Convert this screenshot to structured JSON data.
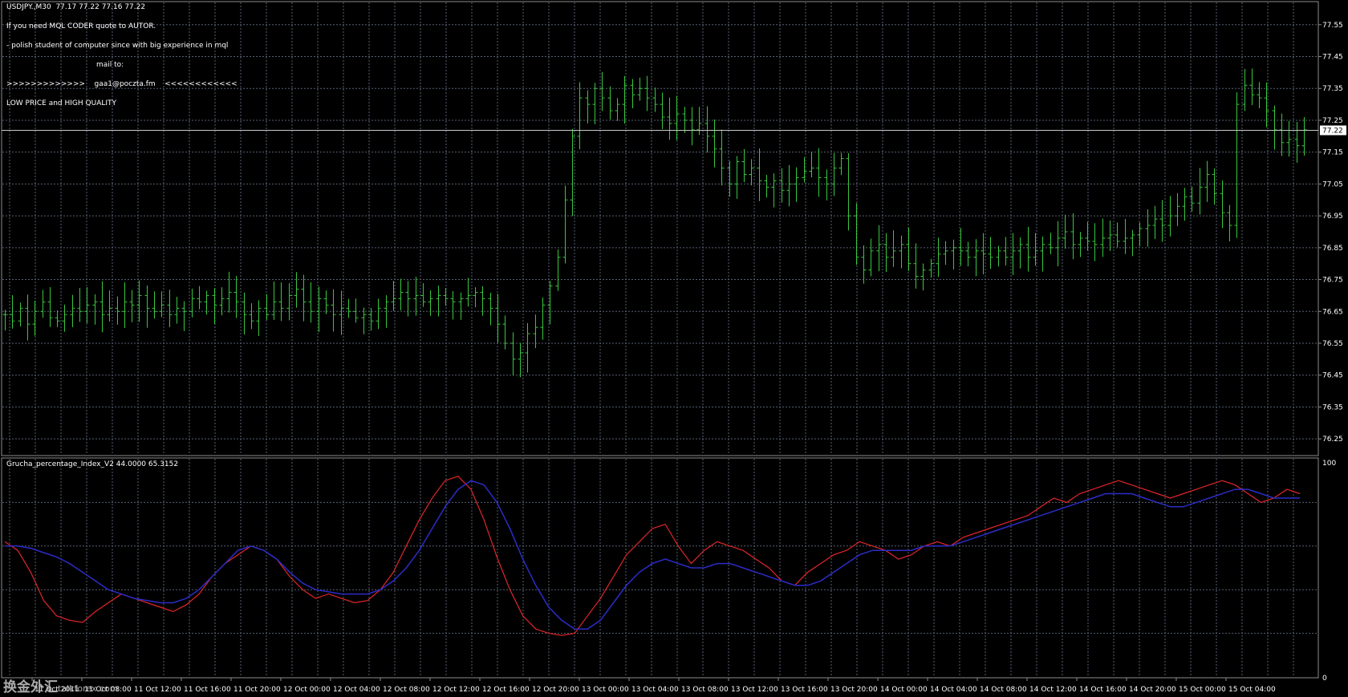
{
  "header": {
    "symbol_line": "USDJPY.,M30  77.17 77.22 77.16 77.22",
    "lines": [
      "If you need MQL CODER quote to AUTOR.",
      "- polish student of computer since with big experience in mql",
      "mail to:",
      ">>>>>>>>>>>>>    gaa1@poczta.fm    <<<<<<<<<<<<",
      "LOW PRICE and HIGH QUALITY"
    ]
  },
  "indicator": {
    "label": "Grucha_percentage_Index_V2 44.0000 65.3152",
    "scale_top": "100",
    "scale_bottom": "0"
  },
  "watermark": {
    "text": "换金外汇",
    "sub": "talkforex.com"
  },
  "colors": {
    "background": "#000000",
    "grid": "#566173",
    "bars": "#39c63e",
    "red_line": "#e0262a",
    "blue_line": "#2c2cc8",
    "text": "#ffffff"
  },
  "chart_data": [
    {
      "type": "ohlc",
      "symbol": "USDJPY.",
      "timeframe": "M30",
      "last_price": "77.22",
      "ylim": [
        76.2,
        77.62
      ],
      "yticks": [
        "77.55",
        "77.45",
        "77.35",
        "77.25",
        "77.15",
        "77.05",
        "76.95",
        "76.85",
        "76.75",
        "76.65",
        "76.55",
        "76.45",
        "76.35",
        "76.25"
      ],
      "close": [
        76.64,
        76.62,
        76.66,
        76.61,
        76.65,
        76.68,
        76.63,
        76.62,
        76.64,
        76.66,
        76.65,
        76.67,
        76.68,
        76.64,
        76.66,
        76.65,
        76.68,
        76.67,
        76.7,
        76.66,
        76.65,
        76.67,
        76.64,
        76.66,
        76.65,
        76.69,
        76.68,
        76.7,
        76.67,
        76.69,
        76.71,
        76.68,
        76.64,
        76.62,
        76.66,
        76.64,
        76.68,
        76.66,
        76.7,
        76.72,
        76.68,
        76.65,
        76.69,
        76.67,
        76.64,
        76.66,
        76.65,
        76.63,
        76.64,
        76.62,
        76.66,
        76.68,
        76.69,
        76.71,
        76.69,
        76.7,
        76.68,
        76.69,
        76.7,
        76.69,
        76.68,
        76.69,
        76.7,
        76.71,
        76.69,
        76.66,
        76.61,
        76.55,
        76.5,
        76.52,
        76.58,
        76.6,
        76.67,
        76.73,
        76.82,
        77.0,
        77.2,
        77.32,
        77.3,
        77.35,
        77.32,
        77.28,
        77.3,
        77.36,
        77.33,
        77.35,
        77.32,
        77.3,
        77.26,
        77.24,
        77.27,
        77.25,
        77.22,
        77.24,
        77.2,
        77.16,
        77.1,
        77.05,
        77.12,
        77.08,
        77.1,
        77.06,
        77.04,
        77.06,
        77.03,
        77.05,
        77.07,
        77.09,
        77.1,
        77.07,
        77.05,
        77.1,
        77.13,
        76.95,
        76.82,
        76.78,
        76.84,
        76.86,
        76.82,
        76.84,
        76.86,
        76.8,
        76.76,
        76.78,
        76.8,
        76.83,
        76.84,
        76.85,
        76.84,
        76.82,
        76.84,
        76.83,
        76.82,
        76.84,
        76.82,
        76.84,
        76.86,
        76.82,
        76.84,
        76.86,
        76.85,
        76.88,
        76.9,
        76.86,
        76.88,
        76.87,
        76.86,
        76.88,
        76.89,
        76.87,
        76.88,
        76.89,
        76.91,
        76.92,
        76.94,
        76.92,
        76.95,
        76.98,
        77.01,
        76.99,
        77.04,
        77.08,
        77.02,
        76.96,
        76.92,
        77.3,
        77.36,
        77.33,
        77.32,
        77.28,
        77.22,
        77.18,
        77.19,
        77.17,
        77.22
      ],
      "yaxis_side": "right"
    },
    {
      "type": "line",
      "title": "Grucha_percentage_Index_V2 44.0000 65.3152",
      "ylim": [
        0,
        100
      ],
      "x": [
        "11 Oct 2011",
        "11 Oct 08:00",
        "11 Oct 12:00",
        "11 Oct 16:00",
        "11 Oct 20:00",
        "12 Oct 00:00",
        "12 Oct 04:00",
        "12 Oct 08:00",
        "12 Oct 12:00",
        "12 Oct 16:00",
        "12 Oct 20:00",
        "13 Oct 00:00",
        "13 Oct 04:00",
        "13 Oct 08:00",
        "13 Oct 12:00",
        "13 Oct 16:00",
        "13 Oct 20:00",
        "14 Oct 00:00",
        "14 Oct 04:00",
        "14 Oct 08:00",
        "14 Oct 12:00",
        "14 Oct 16:00",
        "14 Oct 20:00",
        "15 Oct 00:00",
        "15 Oct 04:00"
      ],
      "series": [
        {
          "name": "",
          "values": [
            62,
            58,
            48,
            35,
            28,
            26,
            25,
            30,
            34,
            38,
            36,
            34,
            32,
            30,
            33,
            38,
            46,
            52,
            56,
            60,
            58,
            54,
            46,
            40,
            36,
            38,
            36,
            34,
            35,
            40,
            48,
            60,
            72,
            82,
            90,
            92,
            86,
            72,
            55,
            40,
            28,
            22,
            20,
            19,
            20,
            28,
            36,
            46,
            56,
            62,
            68,
            70,
            60,
            52,
            58,
            62,
            60,
            58,
            54,
            50,
            44,
            42,
            48,
            52,
            56,
            58,
            62,
            60,
            58,
            54,
            56,
            60,
            62,
            60,
            64,
            66,
            68,
            70,
            72,
            74,
            78,
            82,
            80,
            84,
            86,
            88,
            90,
            88,
            86,
            84,
            82,
            84,
            86,
            88,
            90,
            88,
            84,
            80,
            82,
            86,
            84
          ]
        },
        {
          "name": "",
          "values": [
            60,
            60,
            59,
            57,
            55,
            52,
            48,
            44,
            40,
            38,
            36,
            35,
            34,
            34,
            36,
            40,
            46,
            52,
            58,
            60,
            58,
            54,
            48,
            43,
            40,
            39,
            38,
            38,
            38,
            40,
            44,
            50,
            58,
            68,
            78,
            86,
            90,
            88,
            80,
            68,
            54,
            42,
            32,
            26,
            22,
            22,
            26,
            34,
            42,
            48,
            52,
            54,
            52,
            50,
            50,
            52,
            52,
            50,
            48,
            46,
            44,
            42,
            42,
            44,
            48,
            52,
            56,
            58,
            58,
            58,
            58,
            60,
            60,
            60,
            62,
            64,
            66,
            68,
            70,
            72,
            74,
            76,
            78,
            80,
            82,
            84,
            84,
            84,
            82,
            80,
            78,
            78,
            80,
            82,
            84,
            86,
            86,
            84,
            82,
            82,
            82
          ]
        }
      ],
      "yaxis_side": "right"
    }
  ]
}
